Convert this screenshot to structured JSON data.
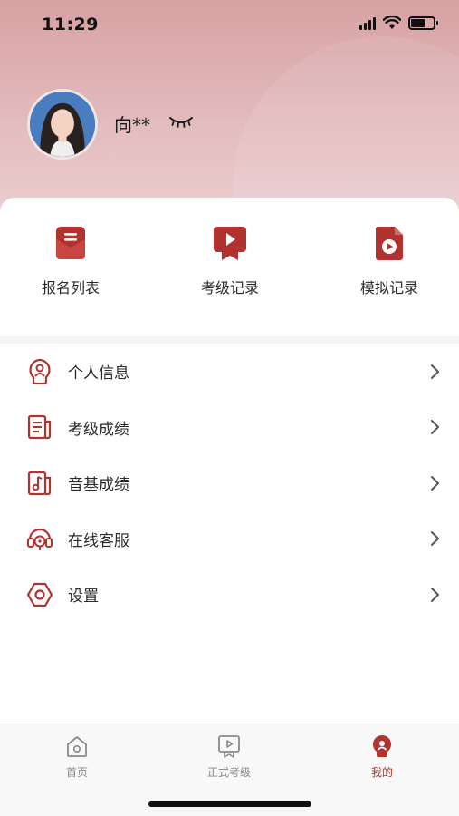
{
  "status_bar": {
    "time": "11:29"
  },
  "profile": {
    "name": "向**"
  },
  "quick_actions": [
    {
      "label": "报名列表",
      "icon": "envelope-list-icon"
    },
    {
      "label": "考级记录",
      "icon": "play-video-icon"
    },
    {
      "label": "模拟记录",
      "icon": "play-file-icon"
    }
  ],
  "menu": [
    {
      "label": "个人信息",
      "icon": "person-info-icon"
    },
    {
      "label": "考级成绩",
      "icon": "grade-doc-icon"
    },
    {
      "label": "音基成绩",
      "icon": "music-doc-icon"
    },
    {
      "label": "在线客服",
      "icon": "headset-icon"
    },
    {
      "label": "设置",
      "icon": "settings-icon"
    }
  ],
  "tabbar": [
    {
      "label": "首页",
      "icon": "home-icon",
      "active": false
    },
    {
      "label": "正式考级",
      "icon": "exam-video-icon",
      "active": false
    },
    {
      "label": "我的",
      "icon": "profile-icon",
      "active": true
    }
  ],
  "colors": {
    "accent": "#b0332f",
    "hero_top": "#d7a1a3"
  }
}
